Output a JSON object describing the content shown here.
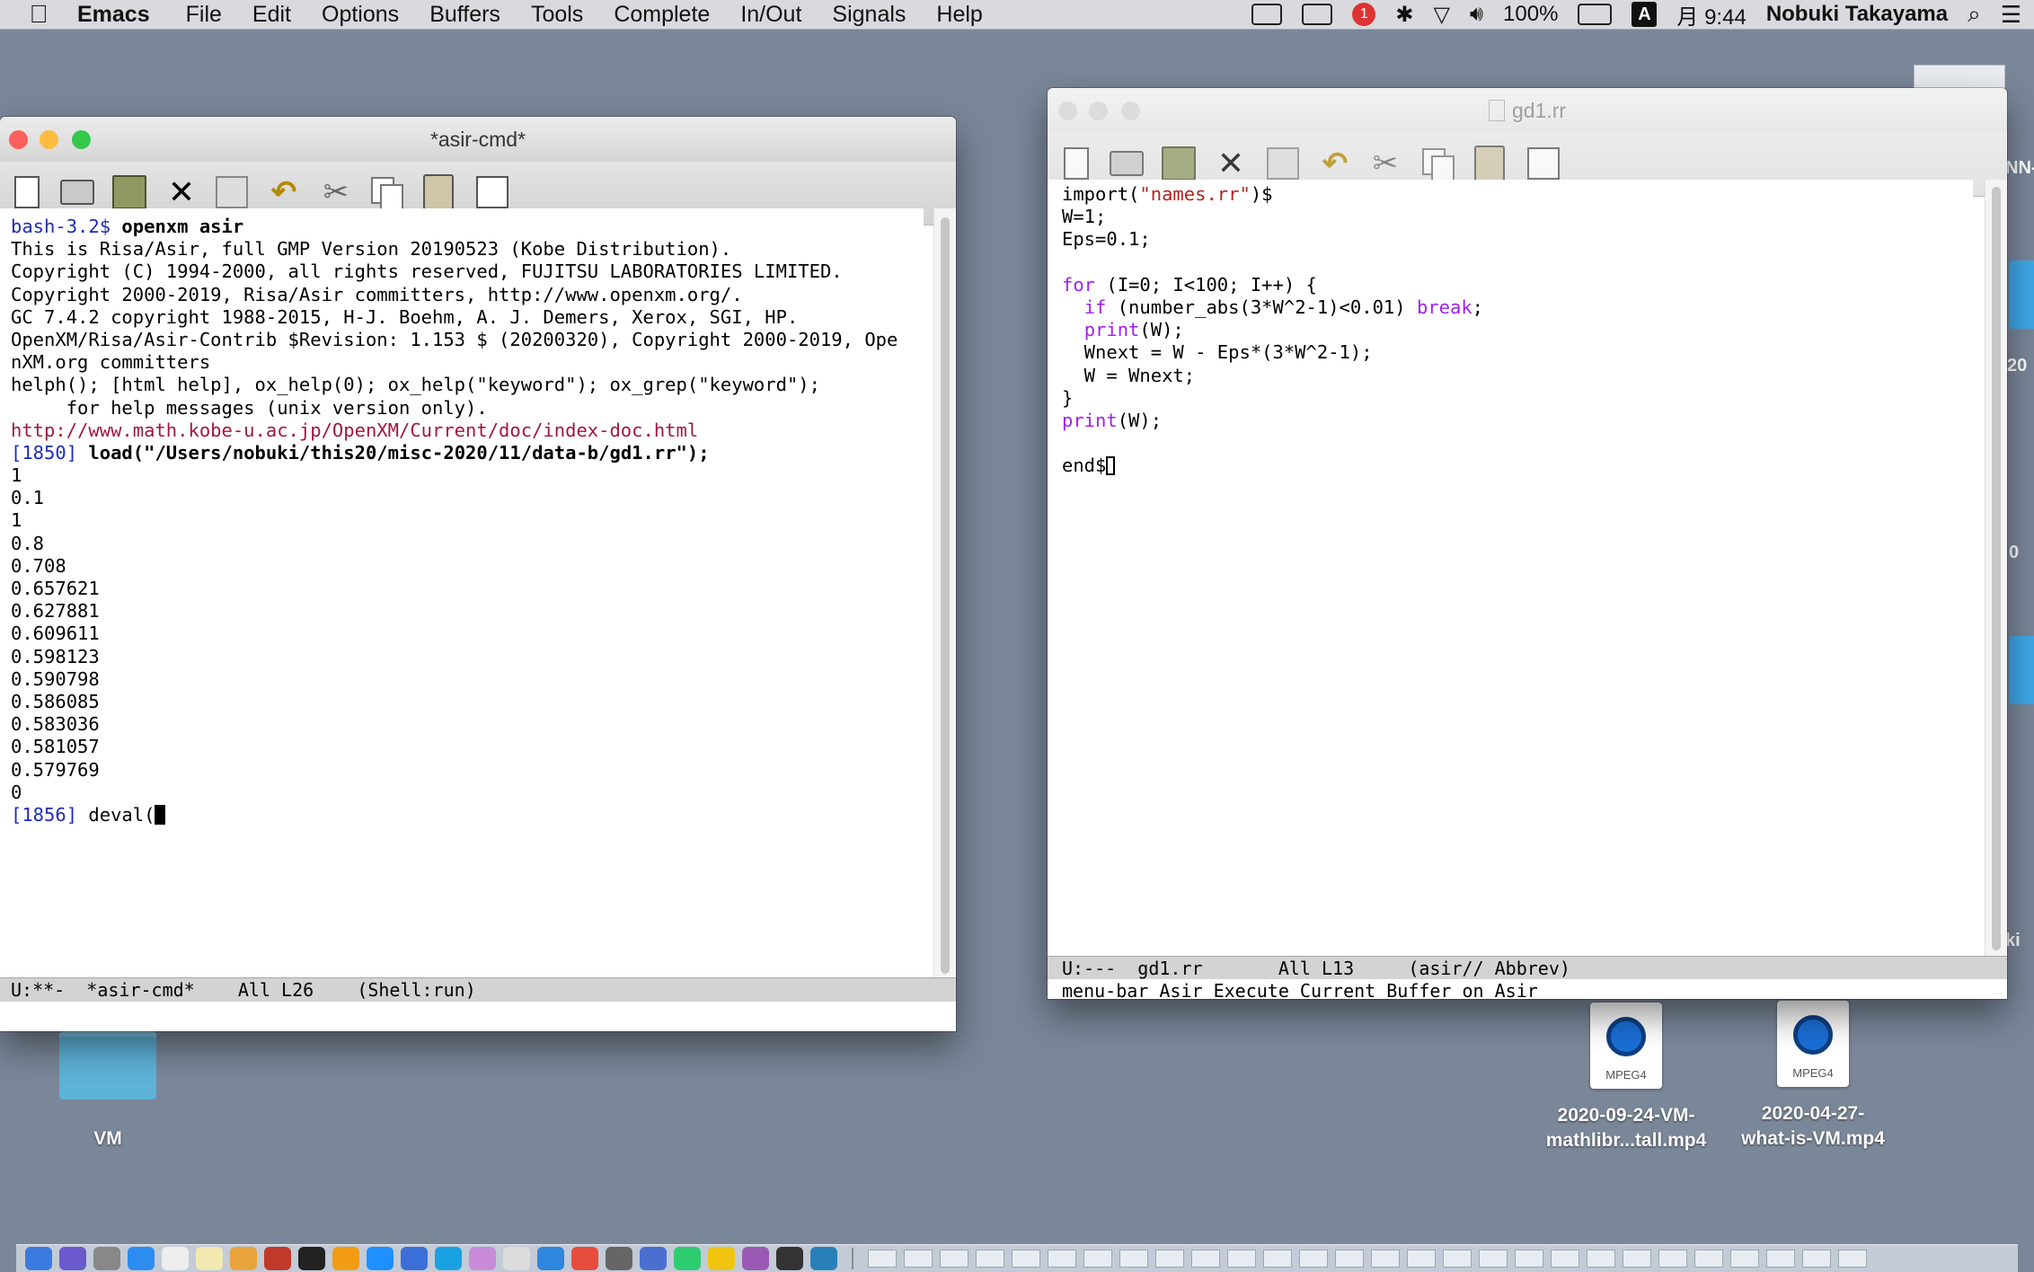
{
  "menubar": {
    "apple": "",
    "app_name": "Emacs",
    "menus": [
      "File",
      "Edit",
      "Options",
      "Buffers",
      "Tools",
      "Complete",
      "In/Out",
      "Signals",
      "Help"
    ],
    "battery": "100%",
    "input_method": "A",
    "clock": "月 9:44",
    "user": "Nobuki Takayama"
  },
  "left_window": {
    "title": "*asir-cmd*",
    "lines": [
      [
        {
          "t": "bash-3.2$ ",
          "c": "prompt"
        },
        {
          "t": "openxm asir",
          "c": "bold"
        }
      ],
      [
        {
          "t": "This is Risa/Asir, full GMP Version 20190523 (Kobe Distribution).",
          "c": ""
        }
      ],
      [
        {
          "t": "Copyright (C) 1994-2000, all rights reserved, FUJITSU LABORATORIES LIMITED.",
          "c": ""
        }
      ],
      [
        {
          "t": "Copyright 2000-2019, Risa/Asir committers, http://www.openxm.org/.",
          "c": ""
        }
      ],
      [
        {
          "t": "GC 7.4.2 copyright 1988-2015, H-J. Boehm, A. J. Demers, Xerox, SGI, HP.",
          "c": ""
        }
      ],
      [
        {
          "t": "OpenXM/Risa/Asir-Contrib $Revision: 1.153 $ (20200320), Copyright 2000-2019, Ope",
          "c": ""
        }
      ],
      [
        {
          "t": "nXM.org committers",
          "c": ""
        }
      ],
      [
        {
          "t": "helph(); [html help], ox_help(0); ox_help(\"keyword\"); ox_grep(\"keyword\");",
          "c": ""
        }
      ],
      [
        {
          "t": "     for help messages (unix version only).",
          "c": ""
        }
      ],
      [
        {
          "t": "http://www.math.kobe-u.ac.jp/OpenXM/Current/doc/index-doc.html",
          "c": "url"
        }
      ],
      [
        {
          "t": "[1850] ",
          "c": "prompt"
        },
        {
          "t": "load(\"/Users/nobuki/this20/misc-2020/11/data-b/gd1.rr\");",
          "c": "bold"
        }
      ],
      [
        {
          "t": "1",
          "c": ""
        }
      ],
      [
        {
          "t": "0.1",
          "c": ""
        }
      ],
      [
        {
          "t": "1",
          "c": ""
        }
      ],
      [
        {
          "t": "0.8",
          "c": ""
        }
      ],
      [
        {
          "t": "0.708",
          "c": ""
        }
      ],
      [
        {
          "t": "0.657621",
          "c": ""
        }
      ],
      [
        {
          "t": "0.627881",
          "c": ""
        }
      ],
      [
        {
          "t": "0.609611",
          "c": ""
        }
      ],
      [
        {
          "t": "0.598123",
          "c": ""
        }
      ],
      [
        {
          "t": "0.590798",
          "c": ""
        }
      ],
      [
        {
          "t": "0.586085",
          "c": ""
        }
      ],
      [
        {
          "t": "0.583036",
          "c": ""
        }
      ],
      [
        {
          "t": "0.581057",
          "c": ""
        }
      ],
      [
        {
          "t": "0.579769",
          "c": ""
        }
      ],
      [
        {
          "t": "0",
          "c": ""
        }
      ],
      [
        {
          "t": "[1856] ",
          "c": "prompt"
        },
        {
          "t": "deval(",
          "c": ""
        },
        {
          "t": "",
          "c": "cursor"
        }
      ]
    ],
    "modeline": "U:**-  *asir-cmd*    All L26    (Shell:run)"
  },
  "right_window": {
    "title": "gd1.rr",
    "lines": [
      [
        {
          "t": "import(",
          "c": ""
        },
        {
          "t": "\"names.rr\"",
          "c": "str"
        },
        {
          "t": ")$",
          "c": ""
        }
      ],
      [
        {
          "t": "W=1;",
          "c": ""
        }
      ],
      [
        {
          "t": "Eps=0.1;",
          "c": ""
        }
      ],
      [
        {
          "t": "",
          "c": ""
        }
      ],
      [
        {
          "t": "for",
          "c": "kw"
        },
        {
          "t": " (I=0; I<100; I++) {",
          "c": ""
        }
      ],
      [
        {
          "t": "  ",
          "c": ""
        },
        {
          "t": "if",
          "c": "kw"
        },
        {
          "t": " (number_abs(3*W^2-1)<0.01) ",
          "c": ""
        },
        {
          "t": "break",
          "c": "kw"
        },
        {
          "t": ";",
          "c": ""
        }
      ],
      [
        {
          "t": "  ",
          "c": ""
        },
        {
          "t": "print",
          "c": "kw"
        },
        {
          "t": "(W);",
          "c": ""
        }
      ],
      [
        {
          "t": "  Wnext = W - Eps*(3*W^2-1);",
          "c": ""
        }
      ],
      [
        {
          "t": "  W = Wnext;",
          "c": ""
        }
      ],
      [
        {
          "t": "}",
          "c": ""
        }
      ],
      [
        {
          "t": "print",
          "c": "kw"
        },
        {
          "t": "(W);",
          "c": ""
        }
      ],
      [
        {
          "t": "",
          "c": ""
        }
      ],
      [
        {
          "t": "end$",
          "c": ""
        },
        {
          "t": "",
          "c": "cursor-hollow"
        }
      ]
    ],
    "modeline": "U:---  gd1.rr       All L13     (asir// Abbrev)",
    "minibuffer": "menu-bar Asir Execute Current Buffer on Asir"
  },
  "desktop": {
    "folder_label": "VM",
    "files": [
      {
        "name_line1": "2020-09-24-VM-",
        "name_line2": "mathlibr...tall.mp4",
        "badge": "MPEG4"
      },
      {
        "name_line1": "2020-04-27-",
        "name_line2": "what-is-VM.mp4",
        "badge": "MPEG4"
      }
    ],
    "edge_labels": [
      "NN-",
      "20",
      "0",
      "ki"
    ]
  },
  "colors": {
    "desktop": "#7a8799",
    "close": "#fc605c",
    "minimize": "#fdbc40",
    "zoom": "#34c84a",
    "prompt": "#1e2db5",
    "url": "#a0183a",
    "keyword": "#a020f0",
    "string": "#b22222"
  }
}
